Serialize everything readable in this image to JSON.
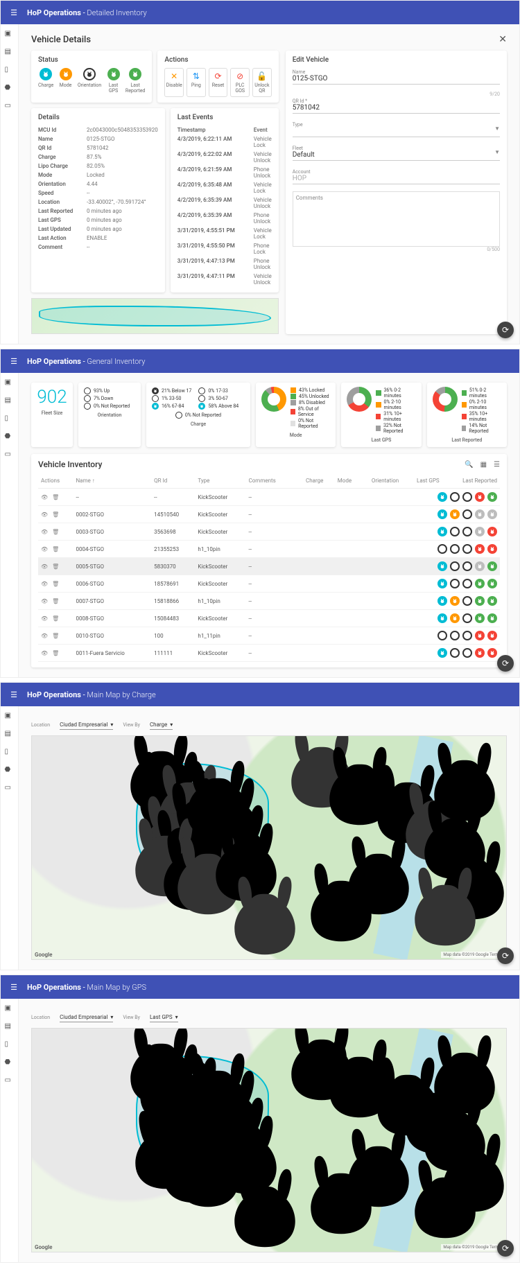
{
  "screens": {
    "detailed": {
      "appbar_title": "HoP Operations",
      "appbar_sub": "Detailed Inventory",
      "heading": "Vehicle Details",
      "status_title": "Status",
      "status_items": [
        "Charge",
        "Mode",
        "Orientation",
        "Last GPS",
        "Last Reported"
      ],
      "actions_title": "Actions",
      "action_labels": {
        "disable": "Disable",
        "ping": "Ping",
        "reset": "Reset",
        "plcgos": "PLC GOS",
        "unlockqr": "Unlock QR"
      },
      "details_title": "Details",
      "details": {
        "mcu_id": {
          "k": "MCU Id",
          "v": "2c0043000c5048353353920"
        },
        "name": {
          "k": "Name",
          "v": "0125-STGO"
        },
        "qr_id": {
          "k": "QR Id",
          "v": "5781042"
        },
        "charge": {
          "k": "Charge",
          "v": "87.5%"
        },
        "lipo": {
          "k": "Lipo Charge",
          "v": "82.05%"
        },
        "mode": {
          "k": "Mode",
          "v": "Locked"
        },
        "orient": {
          "k": "Orientation",
          "v": "4.44"
        },
        "speed": {
          "k": "Speed",
          "v": "--"
        },
        "location": {
          "k": "Location",
          "v": "-33.40002°, -70.591724°"
        },
        "lastrep": {
          "k": "Last Reported",
          "v": "0 minutes ago"
        },
        "lastgps": {
          "k": "Last GPS",
          "v": "0 minutes ago"
        },
        "lastupd": {
          "k": "Last Updated",
          "v": "0 minutes ago"
        },
        "lastact": {
          "k": "Last Action",
          "v": "ENABLE"
        },
        "comment": {
          "k": "Comment",
          "v": "--"
        }
      },
      "events_title": "Last Events",
      "events_headers": {
        "ts": "Timestamp",
        "ev": "Event"
      },
      "events": [
        {
          "ts": "4/3/2019, 6:22:11 AM",
          "ev": "Vehicle Lock"
        },
        {
          "ts": "4/3/2019, 6:22:02 AM",
          "ev": "Vehicle Unlock"
        },
        {
          "ts": "4/3/2019, 6:21:59 AM",
          "ev": "Phone Unlock"
        },
        {
          "ts": "4/2/2019, 6:35:48 AM",
          "ev": "Vehicle Lock"
        },
        {
          "ts": "4/2/2019, 6:35:39 AM",
          "ev": "Vehicle Unlock"
        },
        {
          "ts": "4/2/2019, 6:35:39 AM",
          "ev": "Phone Unlock"
        },
        {
          "ts": "3/31/2019, 4:55:51 PM",
          "ev": "Vehicle Lock"
        },
        {
          "ts": "3/31/2019, 4:55:50 PM",
          "ev": "Phone Lock"
        },
        {
          "ts": "3/31/2019, 4:47:13 PM",
          "ev": "Phone Unlock"
        },
        {
          "ts": "3/31/2019, 4:47:11 PM",
          "ev": "Vehicle Unlock"
        }
      ],
      "form": {
        "title": "Edit Vehicle",
        "name_label": "Name",
        "name": "0125-STGO",
        "name_count": "9/20",
        "qr_label": "QR Id *",
        "qr": "5781042",
        "type_label": "Type",
        "fleet_label": "Fleet",
        "fleet": "Default",
        "account_label": "Account",
        "account": "HOP",
        "comments_label": "Comments",
        "comments_count": "0/500"
      }
    },
    "general": {
      "appbar_title": "HoP Operations",
      "appbar_sub": "General Inventory",
      "fleet_size": {
        "value": "902",
        "title": "Fleet Size"
      },
      "orientation": {
        "title": "Orientation",
        "items": [
          {
            "pct": "93% Up",
            "color": "#fff",
            "border": true
          },
          {
            "pct": "7% Down",
            "color": "#fff",
            "border": true
          },
          {
            "pct": "0% Not Reported",
            "color": "#fff",
            "border": true
          }
        ]
      },
      "charge": {
        "title": "Charge",
        "left": [
          {
            "pct": "21% Below 17",
            "color": "#333"
          },
          {
            "pct": "1% 33-50",
            "color": "#fff",
            "border": true
          },
          {
            "pct": "16% 67-84",
            "color": "#00bcd4"
          }
        ],
        "right": [
          {
            "pct": "0% 17-33",
            "color": "#fff",
            "border": true
          },
          {
            "pct": "3% 50-67",
            "color": "#fff",
            "border": true
          },
          {
            "pct": "58% Above 84",
            "color": "#00bcd4"
          }
        ],
        "bottom": "0% Not Reported"
      },
      "mode": {
        "title": "Mode",
        "items": [
          {
            "pct": "43%  Locked",
            "color": "#ff9800"
          },
          {
            "pct": "45% Unlocked",
            "color": "#4caf50"
          },
          {
            "pct": "8%   Disabled",
            "color": "#9e9e9e"
          },
          {
            "pct": "8%   Out of Service",
            "color": "#f44336"
          },
          {
            "pct": "0%   Not Reported",
            "color": "#e0e0e0"
          }
        ]
      },
      "lastgps": {
        "title": "Last GPS",
        "items": [
          {
            "pct": "36%  0-2 minutes",
            "color": "#4caf50"
          },
          {
            "pct": "0%   2-10 minutes",
            "color": "#ff9800"
          },
          {
            "pct": "31%  10+ minutes",
            "color": "#f44336"
          },
          {
            "pct": "32%  Not Reported",
            "color": "#9e9e9e"
          }
        ]
      },
      "lastrep": {
        "title": "Last Reported",
        "items": [
          {
            "pct": "51%  0-2 minutes",
            "color": "#4caf50"
          },
          {
            "pct": "0%   2-10 minutes",
            "color": "#ff9800"
          },
          {
            "pct": "35%  10+ minutes",
            "color": "#f44336"
          },
          {
            "pct": "14%  Not Reported",
            "color": "#9e9e9e"
          }
        ]
      },
      "inventory_title": "Vehicle Inventory",
      "columns": {
        "actions": "Actions",
        "name": "Name",
        "qr": "QR Id",
        "type": "Type",
        "comments": "Comments",
        "charge": "Charge",
        "mode": "Mode",
        "orientation": "Orientation",
        "lastgps": "Last GPS",
        "lastrep": "Last Reported"
      },
      "rows": [
        {
          "name": "--",
          "qr": "--",
          "type": "KickScooter",
          "comments": "--",
          "dots": [
            "teal",
            "white",
            "white",
            "red",
            "green"
          ]
        },
        {
          "name": "0002-STGO",
          "qr": "14510540",
          "type": "KickScooter",
          "comments": "--",
          "dots": [
            "teal",
            "orange",
            "white",
            "grey",
            "grey"
          ]
        },
        {
          "name": "0003-STGO",
          "qr": "3563698",
          "type": "KickScooter",
          "comments": "--",
          "dots": [
            "teal",
            "white",
            "white",
            "grey",
            "red"
          ]
        },
        {
          "name": "0004-STGO",
          "qr": "21355253",
          "type": "h1_10pin",
          "comments": "--",
          "dots": [
            "white",
            "white",
            "white",
            "red",
            "red"
          ]
        },
        {
          "name": "0005-STGO",
          "qr": "5830370",
          "type": "KickScooter",
          "comments": "--",
          "dots": [
            "teal",
            "white",
            "white",
            "grey",
            "green"
          ],
          "hi": true
        },
        {
          "name": "0006-STGO",
          "qr": "18578691",
          "type": "KickScooter",
          "comments": "--",
          "dots": [
            "teal",
            "white",
            "white",
            "green",
            "green"
          ]
        },
        {
          "name": "0007-STGO",
          "qr": "15818866",
          "type": "h1_10pin",
          "comments": "--",
          "dots": [
            "teal",
            "orange",
            "white",
            "green",
            "green"
          ]
        },
        {
          "name": "0008-STGO",
          "qr": "15084483",
          "type": "KickScooter",
          "comments": "--",
          "dots": [
            "teal",
            "orange",
            "white",
            "green",
            "green"
          ]
        },
        {
          "name": "0010-STGO",
          "qr": "100",
          "type": "h1_11pin",
          "comments": "--",
          "dots": [
            "white",
            "white",
            "white",
            "red",
            "red"
          ]
        },
        {
          "name": "0011-Fuera Servicio",
          "qr": "111111",
          "type": "KickScooter",
          "comments": "--",
          "dots": [
            "teal",
            "white",
            "white",
            "red",
            "red"
          ]
        }
      ]
    },
    "map_charge": {
      "appbar_title": "HoP Operations",
      "appbar_sub": "Main Map by Charge",
      "loc_label": "Location",
      "loc": "Ciudad Empresarial",
      "view_label": "View By",
      "view": "Charge",
      "attribution": "Map data ©2019 Google   Terms",
      "google": "Google"
    },
    "map_gps": {
      "appbar_title": "HoP Operations",
      "appbar_sub": "Main Map by GPS",
      "loc_label": "Location",
      "loc": "Ciudad Empresarial",
      "view_label": "View By",
      "view": "Last GPS",
      "attribution": "Map data ©2019 Google   Terms",
      "google": "Google"
    }
  }
}
